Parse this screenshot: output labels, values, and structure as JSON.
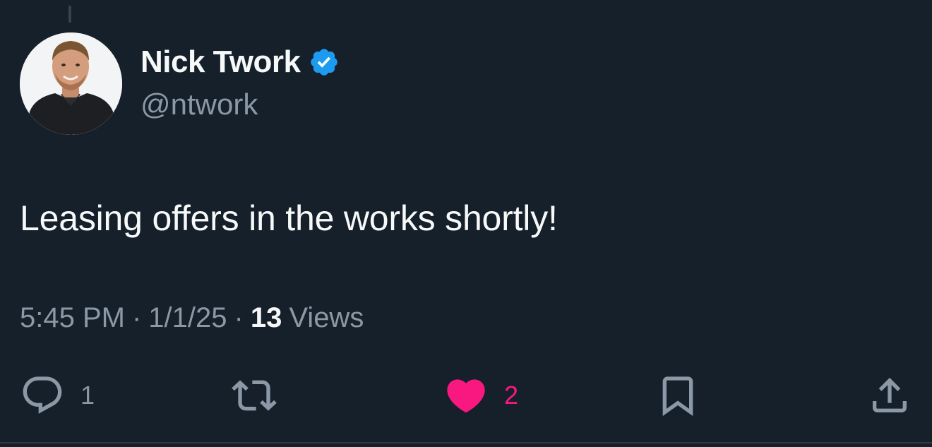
{
  "author": {
    "display_name": "Nick Twork",
    "handle": "@ntwork",
    "verified": true
  },
  "tweet": {
    "text": "Leasing offers in the works shortly!",
    "time": "5:45 PM",
    "date": "1/1/25",
    "separator": "·",
    "views_count": "13",
    "views_label": "Views"
  },
  "actions": {
    "reply_count": "1",
    "retweet_count": "",
    "like_count": "2",
    "liked": true
  },
  "colors": {
    "background": "#15202b",
    "primary_text": "#f7f9f9",
    "secondary_text": "#8b98a5",
    "verified_blue": "#1d9bf0",
    "like_pink": "#f91880"
  },
  "icons": {
    "verified": "verified-badge-icon",
    "reply": "reply-icon",
    "retweet": "retweet-icon",
    "like": "heart-icon",
    "bookmark": "bookmark-icon",
    "share": "share-icon"
  }
}
